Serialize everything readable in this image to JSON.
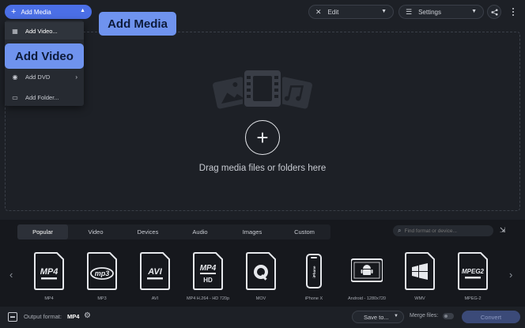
{
  "toolbar": {
    "add_media_label": "Add Media",
    "edit_label": "Edit",
    "settings_label": "Settings"
  },
  "add_media_menu": {
    "items": [
      {
        "label": "Add Video..."
      },
      {
        "label": "Add DVD"
      },
      {
        "label": "Add Folder..."
      }
    ]
  },
  "callouts": {
    "add_media": "Add Media",
    "add_video": "Add Video"
  },
  "dropzone": {
    "prompt": "Drag media files or folders here"
  },
  "format_tabs": [
    {
      "label": "Popular",
      "active": true
    },
    {
      "label": "Video"
    },
    {
      "label": "Devices"
    },
    {
      "label": "Audio"
    },
    {
      "label": "Images"
    },
    {
      "label": "Custom"
    }
  ],
  "format_search": {
    "placeholder": "Find format or device..."
  },
  "formats": [
    {
      "label": "MP4",
      "icon": "mp4-file-icon",
      "badge": "MP4"
    },
    {
      "label": "MP3",
      "icon": "mp3-file-icon",
      "badge": "mp3"
    },
    {
      "label": "AVI",
      "icon": "avi-file-icon",
      "badge": "AVI"
    },
    {
      "label": "MP4 H.264 - HD 720p",
      "icon": "mp4-hd-file-icon",
      "badge": "MP4",
      "badge2": "HD"
    },
    {
      "label": "MOV",
      "icon": "quicktime-file-icon"
    },
    {
      "label": "iPhone X",
      "icon": "iphone-icon",
      "badge": "iPhone"
    },
    {
      "label": "Android - 1280x720",
      "icon": "android-tablet-icon"
    },
    {
      "label": "WMV",
      "icon": "windows-file-icon"
    },
    {
      "label": "MPEG-2",
      "icon": "mpeg2-file-icon",
      "badge": "MPEG2"
    }
  ],
  "statusbar": {
    "output_label": "Output format:",
    "output_value": "MP4",
    "save_to_label": "Save to...",
    "merge_label": "Merge files:",
    "convert_label": "Convert"
  },
  "colors": {
    "accent": "#4b6fe6",
    "callout": "#6f93ee",
    "background": "#1d2026",
    "panel": "#16181d"
  }
}
